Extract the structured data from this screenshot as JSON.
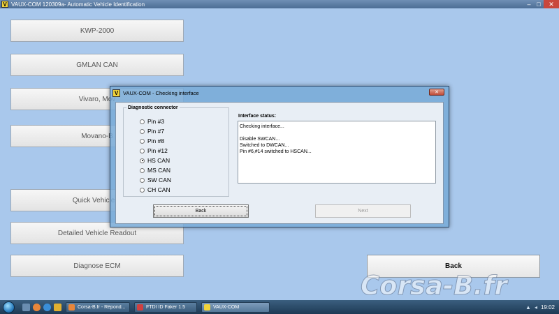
{
  "window": {
    "logo": "V",
    "title": "VAUX-COM 120309a- Automatic Vehicle Identification",
    "controls": {
      "minimize": "–",
      "maximize": "□",
      "close": "✕"
    }
  },
  "main_buttons": [
    {
      "label": "KWP-2000"
    },
    {
      "label": "GMLAN CAN"
    },
    {
      "label": "Vivaro, Mov"
    },
    {
      "label": "Movano-B"
    },
    {
      "label": "Quick Vehicle R"
    },
    {
      "label": "Detailed Vehicle Readout"
    },
    {
      "label": "Diagnose ECM"
    }
  ],
  "back_button": {
    "label": "Back"
  },
  "dialog": {
    "logo": "V",
    "title": "VAUX-COM - Checking interface",
    "close": "✕",
    "diagnostic_connector": {
      "legend": "Diagnostic connector",
      "options": [
        {
          "label": "Pin #3",
          "checked": false
        },
        {
          "label": "Pin #7",
          "checked": false
        },
        {
          "label": "Pin #8",
          "checked": false
        },
        {
          "label": "Pin #12",
          "checked": false
        },
        {
          "label": "HS CAN",
          "checked": true
        },
        {
          "label": "MS CAN",
          "checked": false
        },
        {
          "label": "SW CAN",
          "checked": false
        },
        {
          "label": "CH CAN",
          "checked": false
        }
      ]
    },
    "interface_status": {
      "label": "Interface status:",
      "lines": [
        "Checking interface...",
        "",
        "Disable SWCAN...",
        "Switched to DWCAN...",
        "Pin #6,#14 switched to HSCAN..."
      ]
    },
    "back_label": "Back",
    "next_label": "Next"
  },
  "taskbar": {
    "tasks": [
      {
        "label": "Corsa-B.fr - Répond...",
        "icon_color": "#e8863a"
      },
      {
        "label": "FTDI ID Faker 1.5",
        "icon_color": "#d04040"
      },
      {
        "label": "VAUX-COM",
        "icon_color": "#f2d43a",
        "active": true
      }
    ],
    "clock": "19:02"
  },
  "watermark": "Corsa-B.fr"
}
